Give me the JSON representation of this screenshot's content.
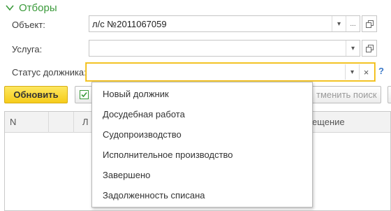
{
  "filters": {
    "group_title": "Отборы",
    "object_label": "Объект:",
    "object_value": "л/с №2011067059",
    "service_label": "Услуга:",
    "service_value": "",
    "status_label": "Статус должника:",
    "status_value": "",
    "help_glyph": "?"
  },
  "toolbar": {
    "refresh_label": "Обновить",
    "cancel_search_label": "тменить поиск"
  },
  "table": {
    "columns": [
      "N",
      "Л",
      "мещение"
    ]
  },
  "status_options": [
    "Новый должник",
    "Досудебная работа",
    "Судопроизводство",
    "Исполнительное производство",
    "Завершено",
    "Задолженность списана"
  ],
  "icons": {
    "dropdown_arrow": "▾",
    "more": "...",
    "clear": "×"
  },
  "colors": {
    "group_title": "#3a9a3a",
    "focus_border": "#f0b400",
    "primary_button": "#f6cc1a",
    "help": "#3b79c9"
  }
}
